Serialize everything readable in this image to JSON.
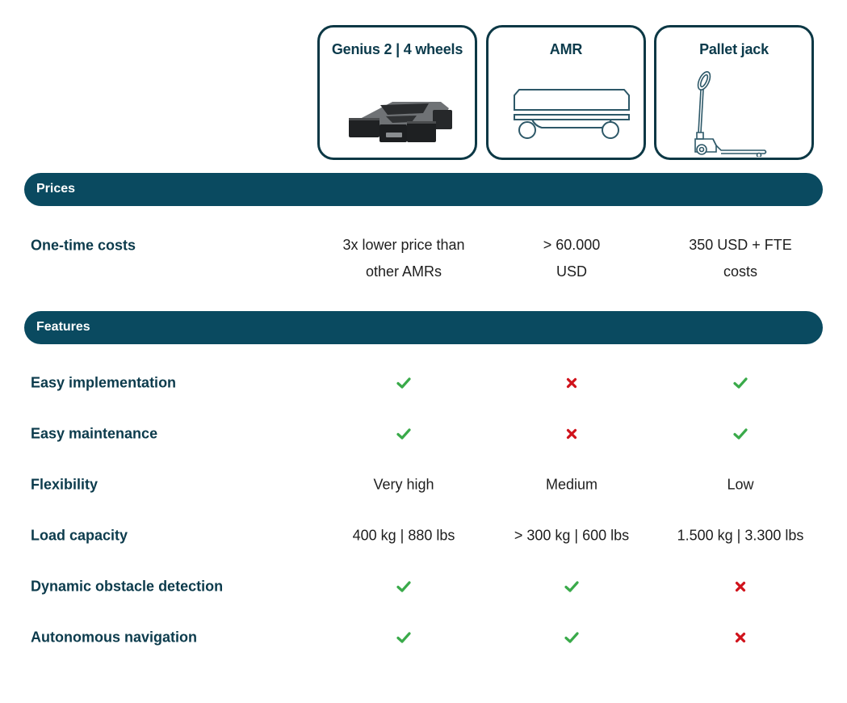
{
  "products": [
    {
      "name": "Genius 2 | 4 wheels",
      "illustration": "robot-photo"
    },
    {
      "name": "AMR",
      "illustration": "amr-outline"
    },
    {
      "name": "Pallet jack",
      "illustration": "pallet-jack-outline"
    }
  ],
  "sections": {
    "prices": {
      "title": "Prices",
      "rows": [
        {
          "label": "One-time costs",
          "values": [
            {
              "type": "text",
              "lines": [
                "3x lower price than",
                "other AMRs"
              ]
            },
            {
              "type": "text",
              "lines": [
                "> 60.000",
                "USD"
              ]
            },
            {
              "type": "text",
              "lines": [
                "350 USD + FTE",
                "costs"
              ]
            }
          ]
        }
      ]
    },
    "features": {
      "title": "Features",
      "rows": [
        {
          "label": "Easy implementation",
          "values": [
            "check",
            "cross",
            "check"
          ]
        },
        {
          "label": "Easy maintenance",
          "values": [
            "check",
            "cross",
            "check"
          ]
        },
        {
          "label": "Flexibility",
          "values": [
            "Very high",
            "Medium",
            "Low"
          ]
        },
        {
          "label": "Load capacity",
          "values": [
            "400 kg | 880 lbs",
            "> 300 kg | 600 lbs",
            "1.500 kg | 3.300 lbs"
          ]
        },
        {
          "label": "Dynamic obstacle detection",
          "values": [
            "check",
            "check",
            "cross"
          ]
        },
        {
          "label": "Autonomous navigation",
          "values": [
            "check",
            "check",
            "cross"
          ]
        }
      ]
    }
  },
  "colors": {
    "primary": "#0a4a60",
    "text_dark": "#0c3b4c",
    "check": "#3aaa4a",
    "cross": "#d0121b"
  }
}
